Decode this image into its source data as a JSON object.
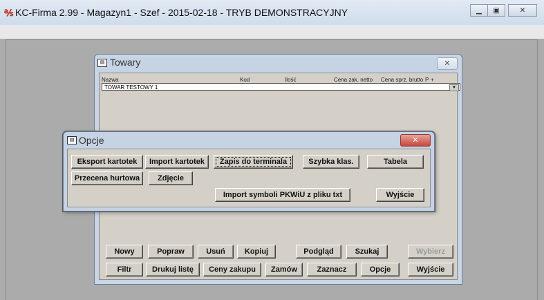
{
  "window": {
    "title": "KC-Firma 2.99 - Magazyn1 - Szef - 2015-02-18 - TRYB DEMONSTRACYJNY",
    "icon": "app-icon"
  },
  "towary": {
    "title": "Towary",
    "columns": [
      "Nazwa",
      "Kod",
      "Ilość",
      "Cena zak. netto",
      "Cena sprz. brutto",
      "P",
      "+"
    ],
    "selected_item": "TOWAR TESTOWY 1",
    "buttons_row1": [
      "Nowy",
      "Popraw",
      "Usuń",
      "Kopiuj",
      "Podgląd",
      "Szukaj",
      "Wybierz"
    ],
    "buttons_row2": [
      "Filtr",
      "Drukuj listę",
      "Ceny zakupu",
      "Zamów",
      "Zaznacz",
      "Opcje",
      "Wyjście"
    ]
  },
  "opcje": {
    "title": "Opcje",
    "row1": [
      "Eksport kartotek",
      "Import kartotek",
      "Zapis do terminala",
      "Szybka klas.",
      "Tabela"
    ],
    "row2": [
      "Przecena hurtowa",
      "Zdjęcie"
    ],
    "import_pkwiu": "Import symboli PKWiU z pliku txt",
    "exit": "Wyjście"
  }
}
